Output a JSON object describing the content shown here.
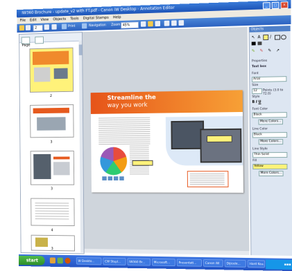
{
  "window": {
    "title": "IW360 Brochure - update_v2 with FT.pdf - Canon iW Desktop - Annotation Editor"
  },
  "menu": [
    "File",
    "Edit",
    "View",
    "Objects",
    "Tools",
    "Digital Stamps",
    "Help"
  ],
  "toolbar": {
    "page": "2",
    "print_label": "Print",
    "navigation_label": "Navigation",
    "zoom_label": "Zoom",
    "zoom_value": "45%"
  },
  "left_panel": {
    "header": "Page",
    "pages": [
      "2",
      "3",
      "3",
      "4",
      "3"
    ]
  },
  "document": {
    "heading1": "Streamline the",
    "heading2": "way you work"
  },
  "right_panel": {
    "objects_title": "Objects",
    "properties_label": "Properties",
    "tool_name": "Text box",
    "font_label": "Font",
    "font_value": "Arial",
    "size_label": "Size",
    "size_value": "12",
    "size_unit": "Points (3.0 to 72.0)",
    "style_label": "Style",
    "font_color_label": "Font Color",
    "font_color_value": "Black",
    "more_colors": "More Colors...",
    "line_color_label": "Line Color",
    "line_color_value": "Black",
    "line_style_label": "Line Style",
    "line_style_value": "Thin Solid",
    "fill_label": "Fill",
    "fill_value": "Yellow"
  },
  "taskbar": {
    "start": "start",
    "items": [
      "W Deskto...",
      "CW Stopl...",
      "IW360 Br...",
      "Microsoft...",
      "Presentati...",
      "Canon iW",
      "Dijicele...",
      "Hard Kea..."
    ]
  },
  "colors": {
    "accent_orange": "#e65419",
    "title_blue": "#2358c4",
    "taskbar_blue": "#2a5fd4",
    "start_green": "#3ca638"
  }
}
